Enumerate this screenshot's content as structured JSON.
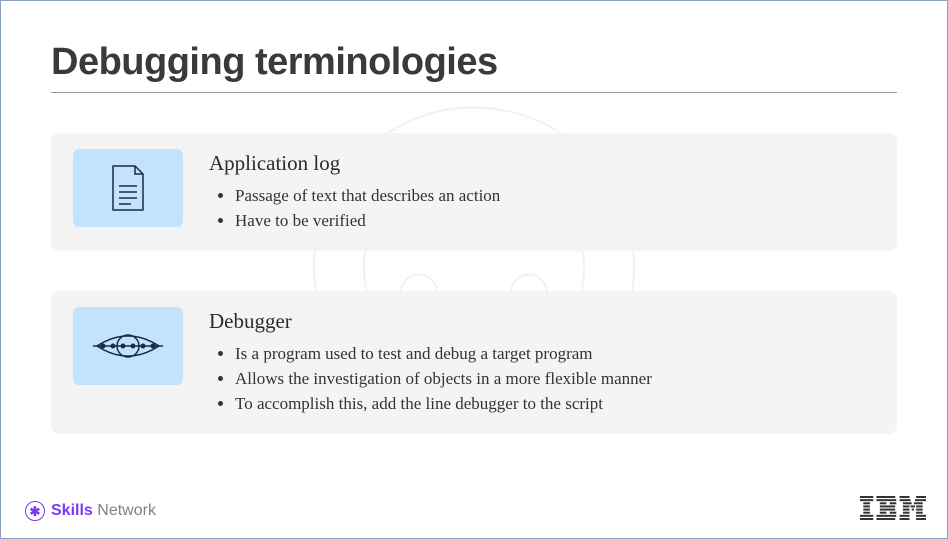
{
  "title": "Debugging terminologies",
  "cards": [
    {
      "heading": "Application log",
      "bullets": [
        "Passage of text that describes an action",
        "Have to be verified"
      ]
    },
    {
      "heading": "Debugger",
      "bullets": [
        "Is a program used to test and debug a target program",
        "Allows the investigation of objects in a more flexible manner",
        "To accomplish this, add the line debugger to the script"
      ]
    }
  ],
  "footer": {
    "skills": "Skills",
    "network": "Network",
    "company": "IBM"
  }
}
